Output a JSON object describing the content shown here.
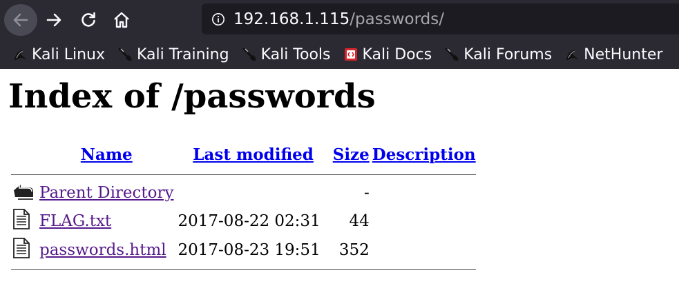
{
  "browser": {
    "url_host": "192.168.1.115",
    "url_path": "/passwords/",
    "bookmarks": [
      {
        "label": "Kali Linux",
        "icon": "kali-dragon-icon"
      },
      {
        "label": "Kali Training",
        "icon": "kali-tools-icon"
      },
      {
        "label": "Kali Tools",
        "icon": "kali-tools-icon"
      },
      {
        "label": "Kali Docs",
        "icon": "kali-docs-icon"
      },
      {
        "label": "Kali Forums",
        "icon": "kali-tools-icon"
      },
      {
        "label": "NetHunter",
        "icon": "kali-dragon-icon"
      }
    ]
  },
  "page": {
    "title": "Index of /passwords",
    "columns": {
      "name": "Name",
      "last_modified": "Last modified",
      "size": "Size",
      "description": "Description"
    },
    "rows": [
      {
        "name": "Parent Directory",
        "modified": "",
        "size": "-",
        "description": "",
        "icon": "back-folder-icon"
      },
      {
        "name": "FLAG.txt",
        "modified": "2017-08-22 02:31",
        "size": "44",
        "description": "",
        "icon": "text-file-icon"
      },
      {
        "name": "passwords.html",
        "modified": "2017-08-23 19:51",
        "size": "352",
        "description": "",
        "icon": "text-file-icon"
      }
    ]
  }
}
